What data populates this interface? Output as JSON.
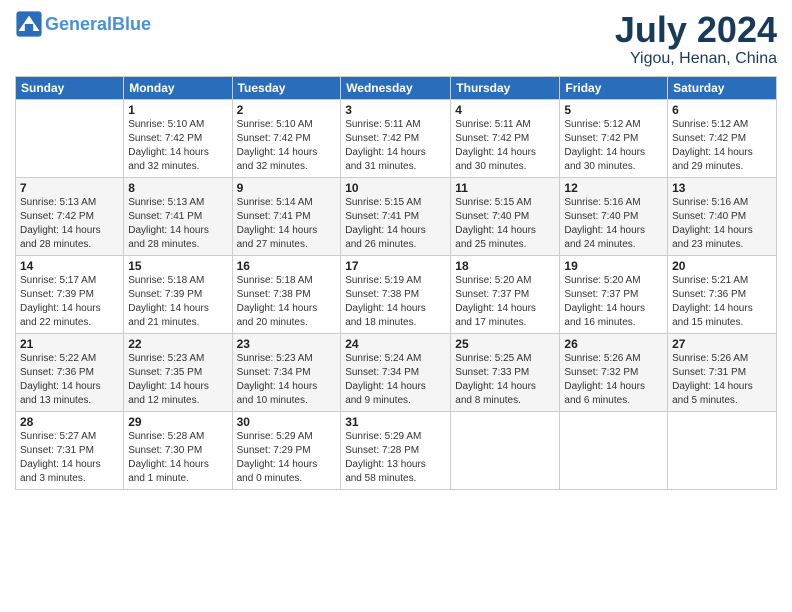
{
  "logo": {
    "text_general": "General",
    "text_blue": "Blue"
  },
  "header": {
    "month": "July 2024",
    "location": "Yigou, Henan, China"
  },
  "weekdays": [
    "Sunday",
    "Monday",
    "Tuesday",
    "Wednesday",
    "Thursday",
    "Friday",
    "Saturday"
  ],
  "weeks": [
    [
      {
        "day": "",
        "info": ""
      },
      {
        "day": "1",
        "info": "Sunrise: 5:10 AM\nSunset: 7:42 PM\nDaylight: 14 hours\nand 32 minutes."
      },
      {
        "day": "2",
        "info": "Sunrise: 5:10 AM\nSunset: 7:42 PM\nDaylight: 14 hours\nand 32 minutes."
      },
      {
        "day": "3",
        "info": "Sunrise: 5:11 AM\nSunset: 7:42 PM\nDaylight: 14 hours\nand 31 minutes."
      },
      {
        "day": "4",
        "info": "Sunrise: 5:11 AM\nSunset: 7:42 PM\nDaylight: 14 hours\nand 30 minutes."
      },
      {
        "day": "5",
        "info": "Sunrise: 5:12 AM\nSunset: 7:42 PM\nDaylight: 14 hours\nand 30 minutes."
      },
      {
        "day": "6",
        "info": "Sunrise: 5:12 AM\nSunset: 7:42 PM\nDaylight: 14 hours\nand 29 minutes."
      }
    ],
    [
      {
        "day": "7",
        "info": "Sunrise: 5:13 AM\nSunset: 7:42 PM\nDaylight: 14 hours\nand 28 minutes."
      },
      {
        "day": "8",
        "info": "Sunrise: 5:13 AM\nSunset: 7:41 PM\nDaylight: 14 hours\nand 28 minutes."
      },
      {
        "day": "9",
        "info": "Sunrise: 5:14 AM\nSunset: 7:41 PM\nDaylight: 14 hours\nand 27 minutes."
      },
      {
        "day": "10",
        "info": "Sunrise: 5:15 AM\nSunset: 7:41 PM\nDaylight: 14 hours\nand 26 minutes."
      },
      {
        "day": "11",
        "info": "Sunrise: 5:15 AM\nSunset: 7:40 PM\nDaylight: 14 hours\nand 25 minutes."
      },
      {
        "day": "12",
        "info": "Sunrise: 5:16 AM\nSunset: 7:40 PM\nDaylight: 14 hours\nand 24 minutes."
      },
      {
        "day": "13",
        "info": "Sunrise: 5:16 AM\nSunset: 7:40 PM\nDaylight: 14 hours\nand 23 minutes."
      }
    ],
    [
      {
        "day": "14",
        "info": "Sunrise: 5:17 AM\nSunset: 7:39 PM\nDaylight: 14 hours\nand 22 minutes."
      },
      {
        "day": "15",
        "info": "Sunrise: 5:18 AM\nSunset: 7:39 PM\nDaylight: 14 hours\nand 21 minutes."
      },
      {
        "day": "16",
        "info": "Sunrise: 5:18 AM\nSunset: 7:38 PM\nDaylight: 14 hours\nand 20 minutes."
      },
      {
        "day": "17",
        "info": "Sunrise: 5:19 AM\nSunset: 7:38 PM\nDaylight: 14 hours\nand 18 minutes."
      },
      {
        "day": "18",
        "info": "Sunrise: 5:20 AM\nSunset: 7:37 PM\nDaylight: 14 hours\nand 17 minutes."
      },
      {
        "day": "19",
        "info": "Sunrise: 5:20 AM\nSunset: 7:37 PM\nDaylight: 14 hours\nand 16 minutes."
      },
      {
        "day": "20",
        "info": "Sunrise: 5:21 AM\nSunset: 7:36 PM\nDaylight: 14 hours\nand 15 minutes."
      }
    ],
    [
      {
        "day": "21",
        "info": "Sunrise: 5:22 AM\nSunset: 7:36 PM\nDaylight: 14 hours\nand 13 minutes."
      },
      {
        "day": "22",
        "info": "Sunrise: 5:23 AM\nSunset: 7:35 PM\nDaylight: 14 hours\nand 12 minutes."
      },
      {
        "day": "23",
        "info": "Sunrise: 5:23 AM\nSunset: 7:34 PM\nDaylight: 14 hours\nand 10 minutes."
      },
      {
        "day": "24",
        "info": "Sunrise: 5:24 AM\nSunset: 7:34 PM\nDaylight: 14 hours\nand 9 minutes."
      },
      {
        "day": "25",
        "info": "Sunrise: 5:25 AM\nSunset: 7:33 PM\nDaylight: 14 hours\nand 8 minutes."
      },
      {
        "day": "26",
        "info": "Sunrise: 5:26 AM\nSunset: 7:32 PM\nDaylight: 14 hours\nand 6 minutes."
      },
      {
        "day": "27",
        "info": "Sunrise: 5:26 AM\nSunset: 7:31 PM\nDaylight: 14 hours\nand 5 minutes."
      }
    ],
    [
      {
        "day": "28",
        "info": "Sunrise: 5:27 AM\nSunset: 7:31 PM\nDaylight: 14 hours\nand 3 minutes."
      },
      {
        "day": "29",
        "info": "Sunrise: 5:28 AM\nSunset: 7:30 PM\nDaylight: 14 hours\nand 1 minute."
      },
      {
        "day": "30",
        "info": "Sunrise: 5:29 AM\nSunset: 7:29 PM\nDaylight: 14 hours\nand 0 minutes."
      },
      {
        "day": "31",
        "info": "Sunrise: 5:29 AM\nSunset: 7:28 PM\nDaylight: 13 hours\nand 58 minutes."
      },
      {
        "day": "",
        "info": ""
      },
      {
        "day": "",
        "info": ""
      },
      {
        "day": "",
        "info": ""
      }
    ]
  ]
}
